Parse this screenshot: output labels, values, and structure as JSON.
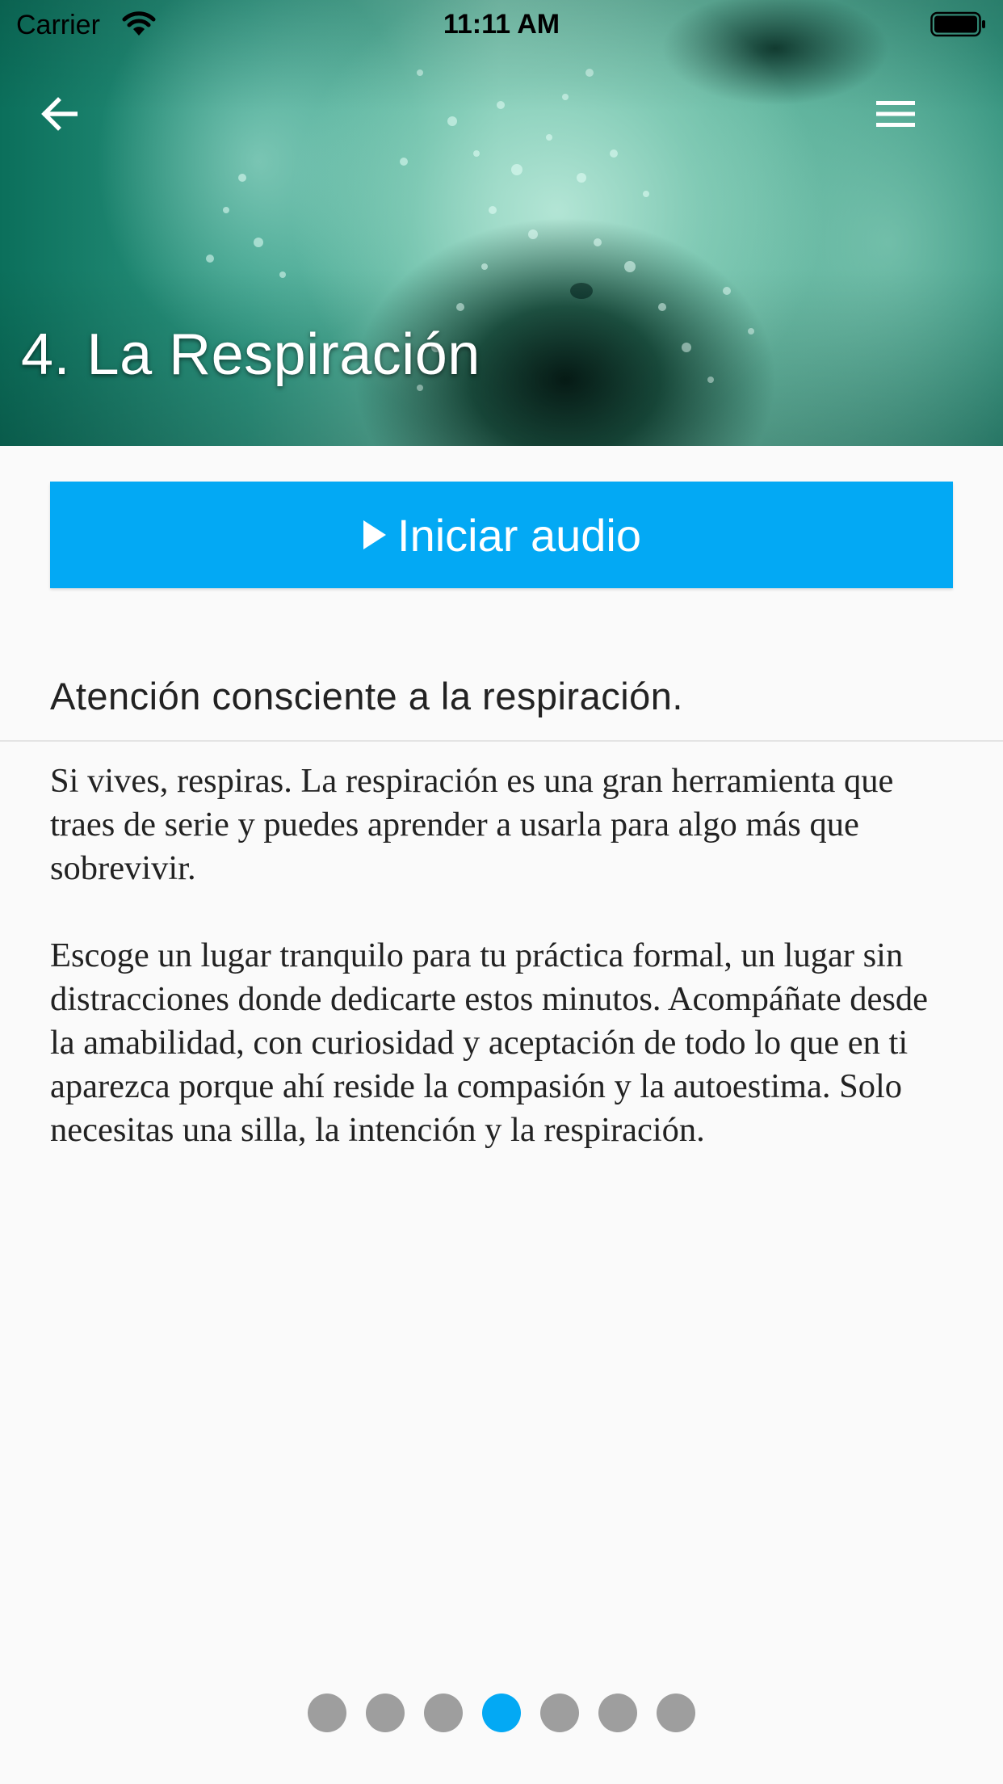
{
  "status_bar": {
    "carrier": "Carrier",
    "time": "11:11 AM"
  },
  "header": {
    "title": "4. La Respiración",
    "back_icon": "arrow-left-icon",
    "menu_icon": "hamburger-menu-icon"
  },
  "audio_button": {
    "label": "Iniciar audio",
    "icon": "play-icon",
    "color": "#03a9f4"
  },
  "content": {
    "subtitle": "Atención consciente a la respiración.",
    "paragraphs": [
      "Si vives, respiras. La respiración es una gran herramienta que traes de serie y puedes aprender a usarla para algo más que sobrevivir.",
      "Escoge un lugar tranquilo para tu práctica formal, un lugar sin distracciones donde dedicarte estos minutos. Acompáñate desde la amabilidad, con curiosidad y aceptación de todo lo que en ti aparezca porque ahí reside la compasión y la autoestima. Solo necesitas una silla, la intención y la respiración."
    ]
  },
  "pager": {
    "total": 7,
    "current": 4,
    "active_color": "#03a9f4",
    "inactive_color": "#9e9e9e"
  }
}
